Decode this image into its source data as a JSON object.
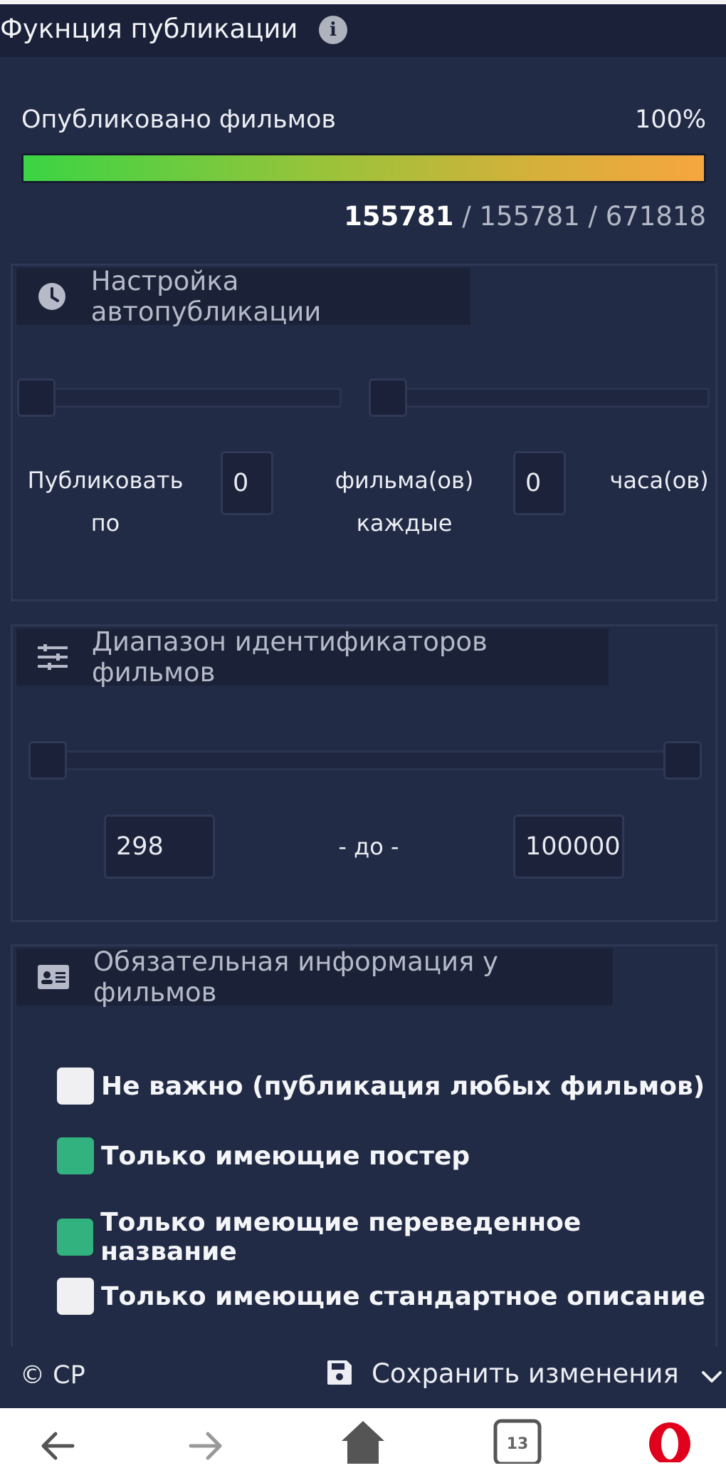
{
  "header": {
    "title": "Фукнция публикации",
    "info_icon": "info-icon"
  },
  "progress": {
    "label": "Опубликовано фильмов",
    "percent_text": "100%",
    "percent": 100,
    "published": "155781",
    "rest": " / 155781 / 671818"
  },
  "autopublish": {
    "title": "Настройка автопубликации",
    "icon": "clock-icon",
    "slider1": 0,
    "slider2": 0,
    "label_publish": "Публиковать по",
    "films_value": "0",
    "label_films_every": "фильма(ов) каждые",
    "hours_value": "0",
    "label_hours": "часа(ов)"
  },
  "id_range": {
    "title": "Диапазон идентификаторов фильмов",
    "icon": "sliders-icon",
    "from_value": "298",
    "to_label": "- до -",
    "to_value": "100000"
  },
  "required_info": {
    "title": "Обязательная информация у фильмов",
    "icon": "id-card-icon",
    "options": [
      {
        "label": "Не важно (публикация любых фильмов)",
        "checked": false
      },
      {
        "label": "Только имеющие постер",
        "checked": true
      },
      {
        "label": "Только имеющие переведенное название",
        "checked": true
      },
      {
        "label": "Только имеющие стандартное описание",
        "checked": false
      }
    ]
  },
  "footer": {
    "copyright": "© CP",
    "save_label": "Сохранить изменения"
  },
  "browser": {
    "tab_count": "13"
  },
  "colors": {
    "accent_green": "#32b27e",
    "bg": "#222b45",
    "header_bg": "#1a2138"
  }
}
